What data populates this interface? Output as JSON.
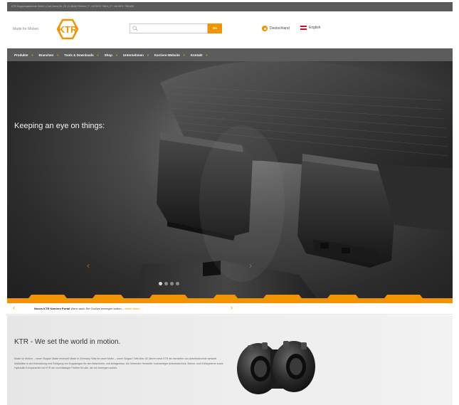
{
  "topbar": {
    "text": "KTR Kupplungstechnik GmbH | Carl-Zeiss-Str. 25 | D-48432 Rheine | T: +49 5971 798-0 | F: +49 5971 798-698"
  },
  "header": {
    "tagline": "Made for Motion",
    "logo_text": "KTR",
    "search_placeholder": "",
    "search_button": "Go",
    "lang_de": "Deutschland",
    "lang_en": "English"
  },
  "nav": {
    "items": [
      {
        "label": "Produkte"
      },
      {
        "label": "Branchen"
      },
      {
        "label": "Tools & Downloads"
      },
      {
        "label": "Shop"
      },
      {
        "label": "Unternehmen"
      },
      {
        "label": "Karriere-Website"
      },
      {
        "label": "Kontakt"
      }
    ]
  },
  "hero": {
    "title": "Keeping an eye on things:",
    "slide_count": 4,
    "active_slide": 1
  },
  "ticker": {
    "headline": "Neues KTR Karriere Portal",
    "text": " Wenn auch Sie Großes bewegen wollen... ",
    "more": "weiter lesen"
  },
  "intro": {
    "title": "KTR - We set the world in motion.",
    "text": "Made for Motion – unser Slogan! Made bedeutet Made in Germany. Was ist unser Motto – unser Slogan? Seit über 50 Jahren setzt KTR als Hersteller von Antriebstechnik weltweit Maßstäbe in der Entwicklung und Fertigung von Kupplungen für den Maschinen- und Anlagenbau. Als führender Hersteller hochwertiger Antriebstechnik, Brems- und Kühlsysteme sowie Hydraulik-Komponenten ist KTR ein zuverlässiger Partner für alle, die viel bewegen wollen."
  },
  "colors": {
    "brand_orange": "#f29400",
    "nav_grey": "#5c5c5c"
  },
  "icons": {
    "search": "search-icon",
    "arrow_left": "chevron-left-icon",
    "arrow_right": "chevron-right-icon"
  }
}
